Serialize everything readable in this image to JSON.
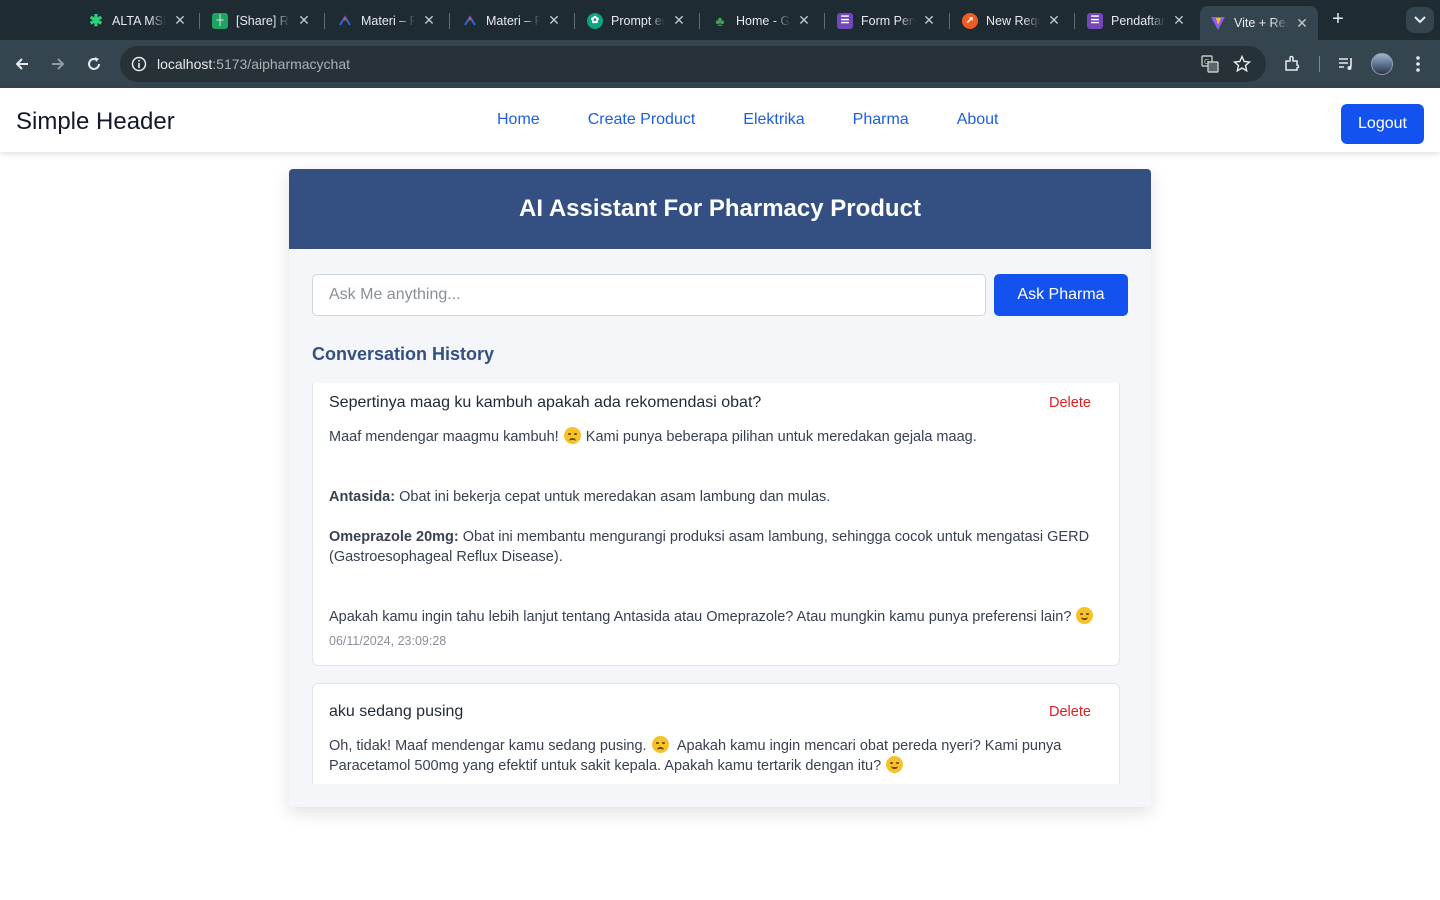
{
  "browser": {
    "tabs": [
      {
        "label": "ALTA MSIB",
        "icon": "asterisk-icon",
        "color": "#2ad37a"
      },
      {
        "label": "[Share] Re",
        "icon": "sheets-icon",
        "color": "#1ea362"
      },
      {
        "label": "Materi – P",
        "icon": "materi-icon",
        "color": "#2f66d8"
      },
      {
        "label": "Materi – P",
        "icon": "materi-icon",
        "color": "#2f66d8"
      },
      {
        "label": "Prompt en",
        "icon": "chatgpt-icon",
        "color": "#10a37f"
      },
      {
        "label": "Home - Ge",
        "icon": "plant-icon",
        "color": "#3fa34d"
      },
      {
        "label": "Form Pen",
        "icon": "forms-icon",
        "color": "#7248b9"
      },
      {
        "label": "New Requ",
        "icon": "postman-icon",
        "color": "#ef5b25"
      },
      {
        "label": "Pendaftar",
        "icon": "forms-icon",
        "color": "#7248b9"
      },
      {
        "label": "Vite + Rea",
        "icon": "vite-icon",
        "color": "#8b5cf6"
      }
    ],
    "url_host": "localhost",
    "url_path": ":5173/aipharmacychat"
  },
  "header": {
    "brand": "Simple Header",
    "nav": [
      "Home",
      "Create Product",
      "Elektrika",
      "Pharma",
      "About"
    ],
    "logout": "Logout"
  },
  "chat": {
    "title": "AI Assistant For Pharmacy Product",
    "input_placeholder": "Ask Me anything...",
    "ask_button": "Ask Pharma",
    "history_title": "Conversation History",
    "delete_label": "Delete",
    "entries": [
      {
        "question": "Sepertinya maag ku kambuh apakah ada rekomendasi obat?",
        "intro_a": "Maaf mendengar maagmu kambuh!",
        "intro_b": "Kami punya beberapa pilihan untuk meredakan gejala maag.",
        "item1_name": "Antasida:",
        "item1_desc": "Obat ini bekerja cepat untuk meredakan asam lambung dan mulas.",
        "item2_name": "Omeprazole 20mg:",
        "item2_desc": "Obat ini membantu mengurangi produksi asam lambung, sehingga cocok untuk mengatasi GERD (Gastroesophageal Reflux Disease).",
        "closing": "Apakah kamu ingin tahu lebih lanjut tentang Antasida atau Omeprazole? Atau mungkin kamu punya preferensi lain?",
        "timestamp": "06/11/2024, 23:09:28"
      },
      {
        "question": "aku sedang pusing",
        "answer_a": "Oh, tidak! Maaf mendengar kamu sedang pusing.",
        "answer_b": "Apakah kamu ingin mencari obat pereda nyeri? Kami punya Paracetamol 500mg yang efektif untuk sakit kepala.  Apakah kamu tertarik dengan itu?"
      }
    ]
  }
}
